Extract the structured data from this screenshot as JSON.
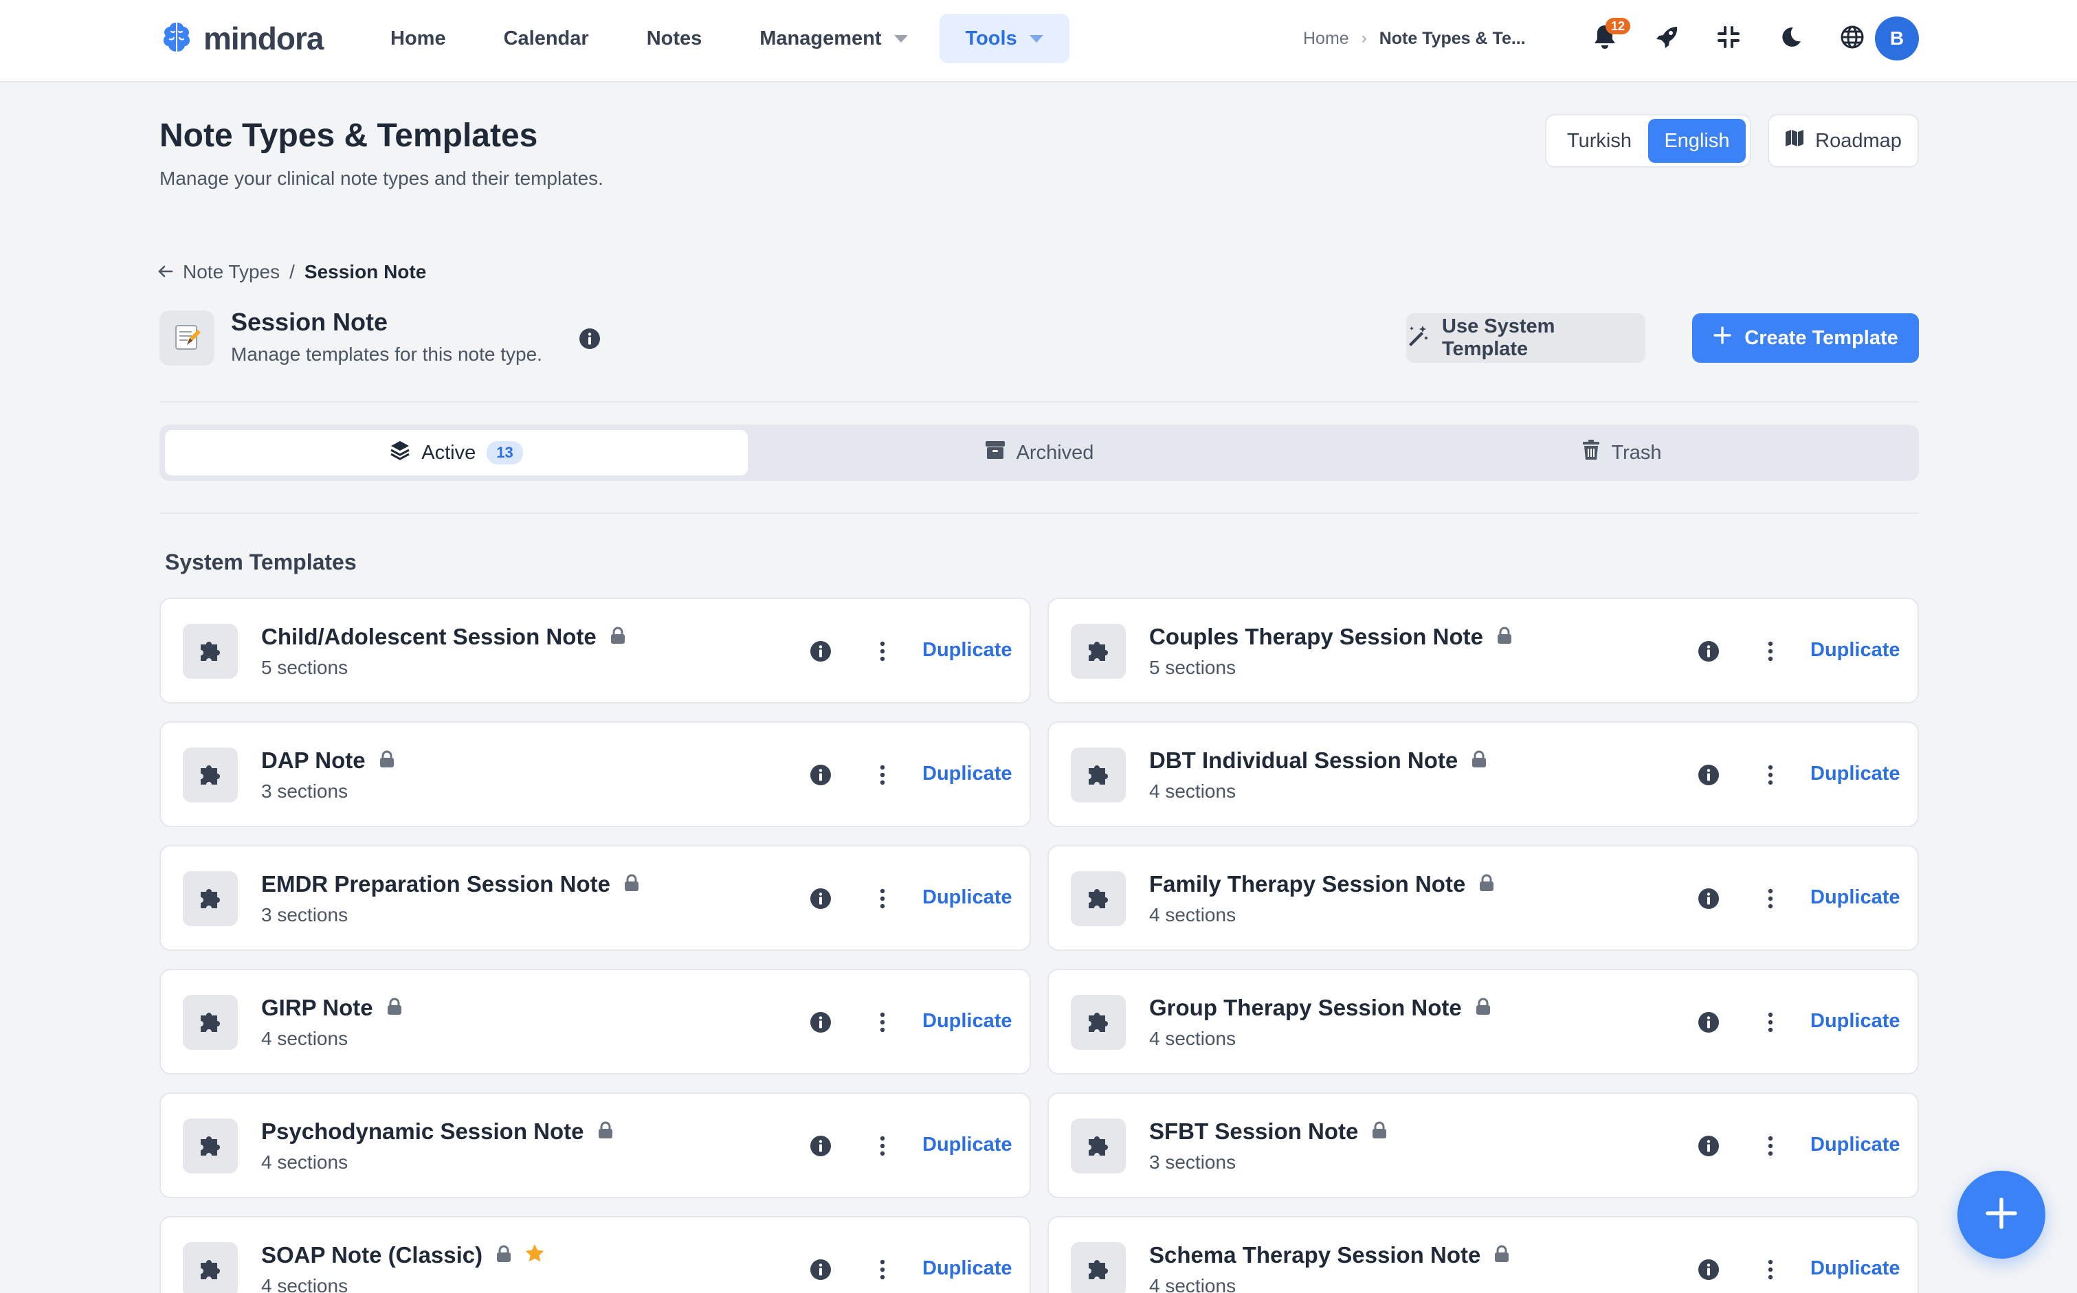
{
  "app": {
    "brand": "mindora"
  },
  "nav": {
    "links": [
      {
        "label": "Home"
      },
      {
        "label": "Calendar"
      },
      {
        "label": "Notes"
      },
      {
        "label": "Management"
      },
      {
        "label": "Tools"
      }
    ],
    "breadcrumb": {
      "home": "Home",
      "current": "Note Types & Te..."
    },
    "notifications_count": "12",
    "avatar_initial": "B"
  },
  "header": {
    "title": "Note Types & Templates",
    "subtitle": "Manage your clinical note types and their templates.",
    "languages": [
      "Turkish",
      "English"
    ],
    "selected_language": "English",
    "roadmap_label": "Roadmap"
  },
  "subcrumb": {
    "back": "Note Types",
    "separator": "/",
    "current": "Session Note"
  },
  "note_type": {
    "title": "Session Note",
    "subtitle": "Manage templates for this note type.",
    "use_system_label": "Use System Template",
    "create_label": "Create Template"
  },
  "tabs": [
    {
      "label": "Active",
      "count": "13"
    },
    {
      "label": "Archived"
    },
    {
      "label": "Trash"
    }
  ],
  "section": {
    "heading": "System Templates"
  },
  "templates": [
    {
      "name": "Child/Adolescent Session Note",
      "sections": "5 sections",
      "starred": false
    },
    {
      "name": "Couples Therapy Session Note",
      "sections": "5 sections",
      "starred": false
    },
    {
      "name": "DAP Note",
      "sections": "3 sections",
      "starred": false
    },
    {
      "name": "DBT Individual Session Note",
      "sections": "4 sections",
      "starred": false
    },
    {
      "name": "EMDR Preparation Session Note",
      "sections": "3 sections",
      "starred": false
    },
    {
      "name": "Family Therapy Session Note",
      "sections": "4 sections",
      "starred": false
    },
    {
      "name": "GIRP Note",
      "sections": "4 sections",
      "starred": false
    },
    {
      "name": "Group Therapy Session Note",
      "sections": "4 sections",
      "starred": false
    },
    {
      "name": "Psychodynamic Session Note",
      "sections": "4 sections",
      "starred": false
    },
    {
      "name": "SFBT Session Note",
      "sections": "3 sections",
      "starred": false
    },
    {
      "name": "SOAP Note (Classic)",
      "sections": "4 sections",
      "starred": true
    },
    {
      "name": "Schema Therapy Session Note",
      "sections": "4 sections",
      "starred": false
    }
  ],
  "card_action_label": "Duplicate",
  "colors": {
    "accent": "#3b82f6",
    "link": "#2b6fe0",
    "star": "#f5a623",
    "badge": "#ea6a1e"
  }
}
